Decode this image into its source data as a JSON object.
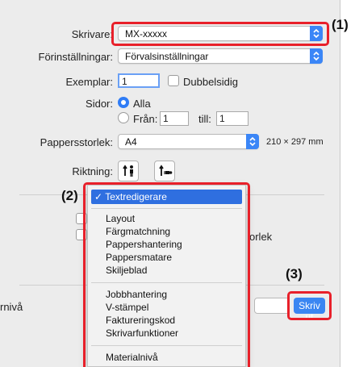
{
  "printer": {
    "label": "Skrivare:",
    "value": "MX-xxxxx"
  },
  "presets": {
    "label": "Förinställningar:",
    "value": "Förvalsinställningar"
  },
  "copies": {
    "label": "Exemplar:",
    "value": "1",
    "duplex_label": "Dubbelsidig"
  },
  "pages": {
    "label": "Sidor:",
    "all_label": "Alla",
    "from_label": "Från:",
    "from_value": "1",
    "to_label": "till:",
    "to_value": "1"
  },
  "paper_size": {
    "label": "Pappersstorlek:",
    "value": "A4",
    "dimensions": "210 × 297 mm"
  },
  "orientation": {
    "label": "Riktning:"
  },
  "menu": {
    "selected": "Textredigerare",
    "checkmark": "✓",
    "group1": [
      "Layout",
      "Färgmatchning",
      "Pappershantering",
      "Pappersmatare",
      "Skiljeblad"
    ],
    "group2": [
      "Jobbhantering",
      "V-stämpel",
      "Faktureringskod",
      "Skrivarfunktioner"
    ],
    "group3": [
      "Materialnivå"
    ]
  },
  "background_text": {
    "right_fragment": "orlek",
    "left_fragment": "rnivå"
  },
  "print_button": "Skriv ut",
  "callouts": {
    "c1": "(1)",
    "c2": "(2)",
    "c3": "(3)"
  },
  "colors": {
    "accent": "#3a86f2",
    "callout": "#e8202a",
    "dialog_bg": "#ececec"
  }
}
